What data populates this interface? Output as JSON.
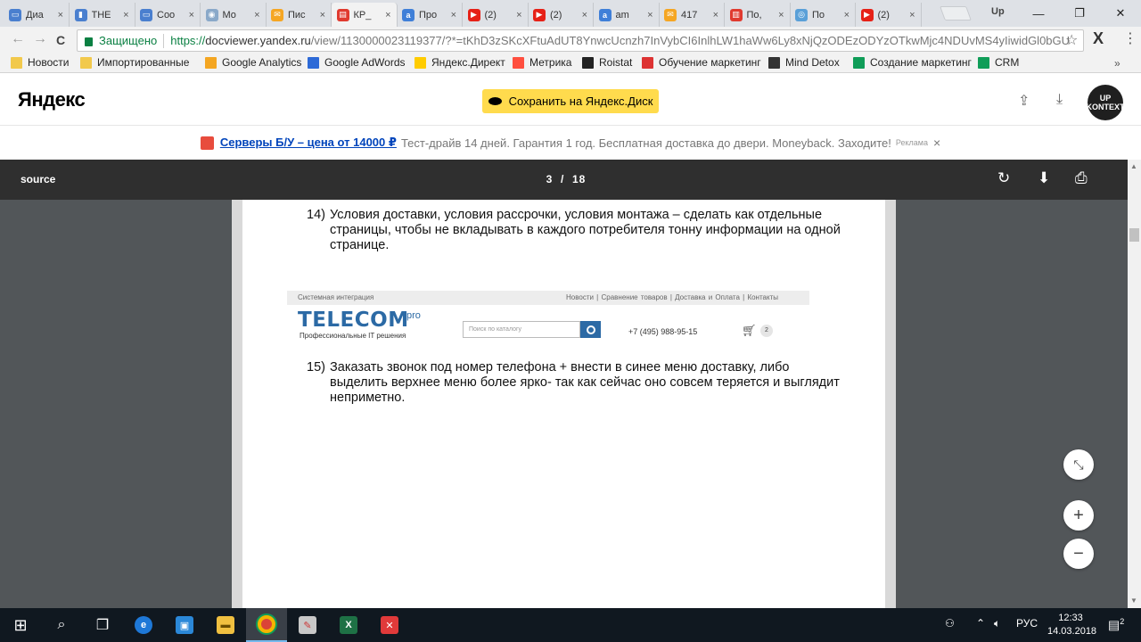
{
  "tabs": [
    {
      "title": "Диа",
      "color": "#4a7fcf",
      "glyph": "▭"
    },
    {
      "title": "THE",
      "color": "#4a7fcf",
      "glyph": "▮"
    },
    {
      "title": "Coo",
      "color": "#4a7fcf",
      "glyph": "▭"
    },
    {
      "title": "Мо",
      "color": "#8aa9c9",
      "glyph": "◉"
    },
    {
      "title": "Пис",
      "color": "#f5a623",
      "glyph": "✉"
    },
    {
      "title": "КР_",
      "color": "#e03a2f",
      "glyph": "▤"
    },
    {
      "title": "Про",
      "color": "#3f7fd8",
      "glyph": "a"
    },
    {
      "title": "(2)",
      "color": "#e62117",
      "glyph": "▶"
    },
    {
      "title": "(2)",
      "color": "#e62117",
      "glyph": "▶"
    },
    {
      "title": "am",
      "color": "#3f7fd8",
      "glyph": "a"
    },
    {
      "title": "417",
      "color": "#f5a623",
      "glyph": "✉"
    },
    {
      "title": "По,",
      "color": "#e03a2f",
      "glyph": "▥"
    },
    {
      "title": "По",
      "color": "#5aa0d8",
      "glyph": "◎"
    },
    {
      "title": "(2)",
      "color": "#e62117",
      "glyph": "▶"
    }
  ],
  "active_tab_index": 5,
  "tab_close": "×",
  "profile_label": "Up",
  "window_controls": {
    "minimize": "—",
    "maximize": "❐",
    "close": "✕"
  },
  "toolbar": {
    "back": "←",
    "forward": "→",
    "reload": "C",
    "secure_label": "Защищено",
    "url_scheme": "https://",
    "url_host": "docviewer.yandex.ru",
    "url_path": "/view/1130000023119377/?*=tKhD3zSKcXFtuAdUT8YnwcUcnzh7InVybCI6InlhLW1haWw6Ly8xNjQzODEzODYzOTkwMjc4NDUvMS4yIiwidGl0bGU",
    "star": "☆",
    "menu_x": "X",
    "menu": "⋮"
  },
  "bookmarks": [
    {
      "label": "Новости",
      "color": "#f2c94c"
    },
    {
      "label": "Импортированные",
      "color": "#f2c94c"
    },
    {
      "label": "Google Analytics",
      "color": "#f4a622"
    },
    {
      "label": "Google AdWords",
      "color": "#2d6ad7"
    },
    {
      "label": "Яндекс.Директ",
      "color": "#ffcc00"
    },
    {
      "label": "Метрика",
      "color": "#ff4f3f"
    },
    {
      "label": "Roistat",
      "color": "#222222"
    },
    {
      "label": "Обучение маркетинг",
      "color": "#d33"
    },
    {
      "label": "Mind Detox",
      "color": "#333"
    },
    {
      "label": "Создание маркетинг",
      "color": "#0f9d58"
    },
    {
      "label": "CRM",
      "color": "#0f9d58"
    }
  ],
  "bookmarks_more": "»",
  "header": {
    "logo": "Яндекс",
    "save_button": "Сохранить на Яндекс.Диск",
    "share_icon": "⇪",
    "download_icon": "⤓",
    "avatar_text": "UP KONTEXT"
  },
  "ad": {
    "link": "Серверы Б/У – цена от 14000 ₽",
    "text": "Тест-драйв 14 дней. Гарантия 1 год. Бесплатная доставка до двери. Moneyback. Заходите!",
    "mark": "Реклама",
    "close": "×"
  },
  "viewer": {
    "source": "source",
    "page_current": "3",
    "page_total": "18",
    "page_sep": "/",
    "rotate_icon": "↻",
    "download_icon": "⬇",
    "print_icon": "⎙"
  },
  "document": {
    "p14_num": "14)",
    "p14_text": "Условия доставки, условия рассрочки, условия монтажа – сделать как отдельные страницы, чтобы не вкладывать в каждого потребителя тонну информации на одной странице.",
    "p15_num": "15)",
    "p15_text": "Заказать звонок под номер телефона + внести в синее меню доставку, либо выделить верхнее меню более ярко- так как сейчас оно совсем теряется и выглядит неприметно.",
    "screenshot": {
      "top_left": "Системная интеграция",
      "nav": "Новости  |  Сравнение товаров  |  Доставка и Оплата  |  Контакты",
      "logo": "TELECOM",
      "logo_sup": "pro",
      "tagline": "Профессиональные IT решения",
      "search_placeholder": "Поиск по каталогу",
      "phone": "+7 (495) 988-95-15",
      "cart_count": "2"
    }
  },
  "float_buttons": {
    "fit": "⤡",
    "zoom_in": "+",
    "zoom_out": "−"
  },
  "taskbar": {
    "start": "⊞",
    "search": "⌕",
    "taskview": "❐",
    "lang": "РУС",
    "time": "12:33",
    "date": "14.03.2018",
    "notif_count": "2"
  }
}
